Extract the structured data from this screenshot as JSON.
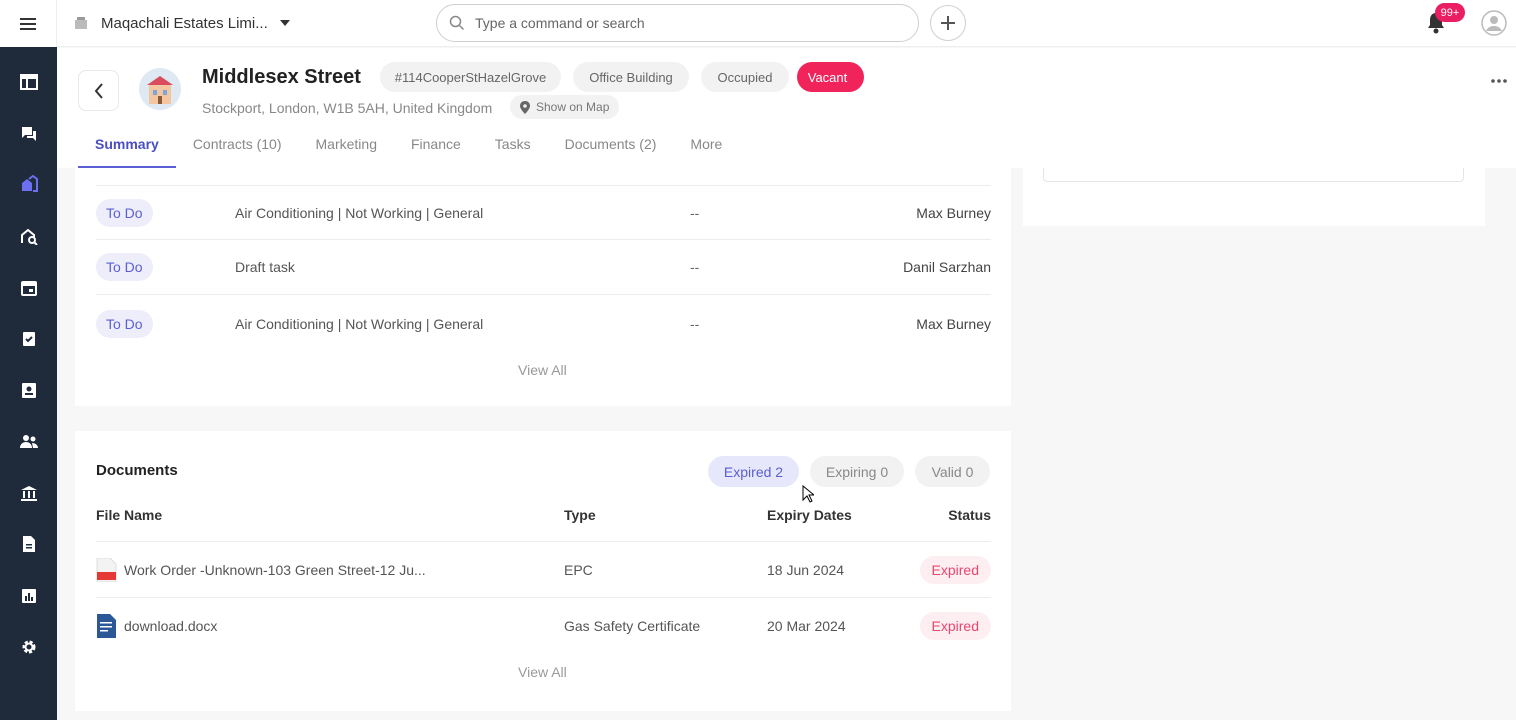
{
  "topbar": {
    "company_name": "Maqachali Estates Limi...",
    "search_placeholder": "Type a command or search",
    "notification_count": "99+"
  },
  "property": {
    "title": "Middlesex Street",
    "reference": "#114CooperStHazelGrove",
    "type": "Office Building",
    "occupancy": "Occupied",
    "status": "Vacant",
    "address": "Stockport, London, W1B 5AH, United Kingdom",
    "map_label": "Show on Map"
  },
  "tabs": [
    {
      "label": "Summary",
      "active": true
    },
    {
      "label": "Contracts (10)"
    },
    {
      "label": "Marketing"
    },
    {
      "label": "Finance"
    },
    {
      "label": "Tasks"
    },
    {
      "label": "Documents (2)"
    },
    {
      "label": "More"
    }
  ],
  "tasks": {
    "rows": [
      {
        "status": "To Do",
        "title": "Air Conditioning | Not Working | General",
        "due": "--",
        "assignee": "Max Burney"
      },
      {
        "status": "To Do",
        "title": "Draft task",
        "due": "--",
        "assignee": "Danil Sarzhan"
      },
      {
        "status": "To Do",
        "title": "Air Conditioning | Not Working | General",
        "due": "--",
        "assignee": "Max Burney"
      }
    ],
    "view_all": "View All"
  },
  "documents": {
    "title": "Documents",
    "filters": [
      {
        "label": "Expired 2",
        "active": true
      },
      {
        "label": "Expiring 0"
      },
      {
        "label": "Valid 0"
      }
    ],
    "columns": [
      "File Name",
      "Type",
      "Expiry Dates",
      "Status"
    ],
    "rows": [
      {
        "icon": "pdf-file-icon",
        "name": "Work Order -Unknown-103 Green Street-12 Ju...",
        "type": "EPC",
        "expiry": "18 Jun 2024",
        "status": "Expired"
      },
      {
        "icon": "docx-file-icon",
        "name": "download.docx",
        "type": "Gas Safety Certificate",
        "expiry": "20 Mar 2024",
        "status": "Expired"
      }
    ],
    "view_all": "View All"
  },
  "colors": {
    "sidebar": "#1f2a3a",
    "accent": "#5b5fd3",
    "vacant": "#f0245a",
    "expired": "#e8466f"
  }
}
